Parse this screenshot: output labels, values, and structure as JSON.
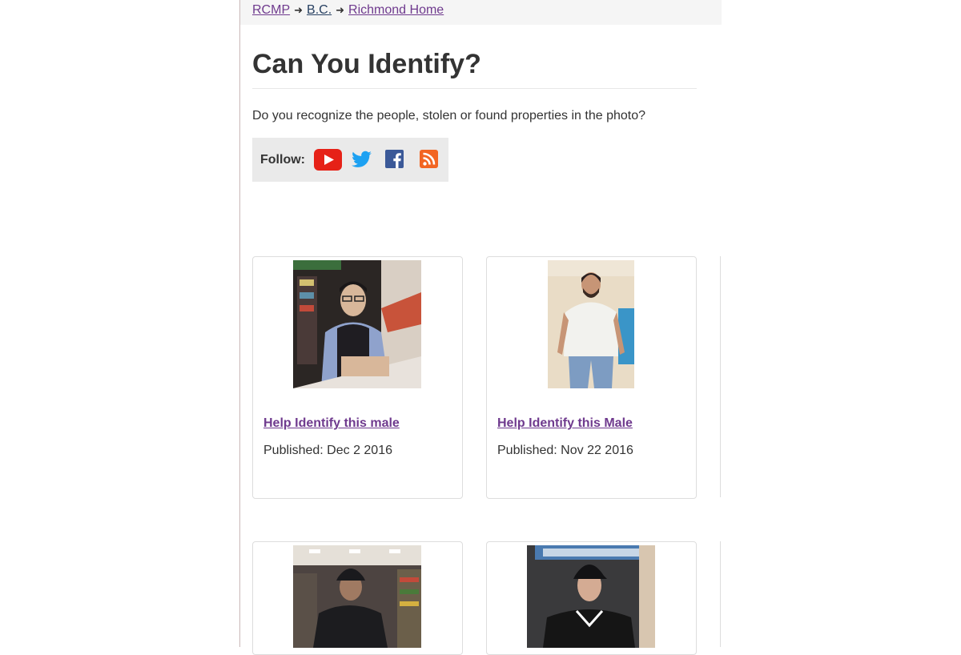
{
  "breadcrumb": {
    "items": [
      {
        "label": "RCMP"
      },
      {
        "label": "B.C."
      },
      {
        "label": "Richmond Home"
      }
    ],
    "separator": "➜"
  },
  "page": {
    "title": "Can You Identify?",
    "intro": "Do you recognize the people, stolen or found properties in the photo?"
  },
  "follow": {
    "label": "Follow:",
    "icons": [
      "youtube-icon",
      "twitter-icon",
      "facebook-icon",
      "rss-icon"
    ]
  },
  "cards": [
    {
      "link": "Help Identify this male",
      "published": "Published: Dec 2 2016"
    },
    {
      "link": "Help Identify this Male",
      "published": "Published: Nov 22 2016"
    },
    {
      "link": "",
      "published": ""
    },
    {
      "link": "",
      "published": ""
    }
  ],
  "colors": {
    "link_visited": "#6f3a8e",
    "breadcrumb_bg": "#f5f5f5",
    "follow_bg": "#eaeaea",
    "youtube": "#e62117",
    "twitter": "#1da1f2",
    "facebook": "#3b5998",
    "rss": "#f26522"
  }
}
